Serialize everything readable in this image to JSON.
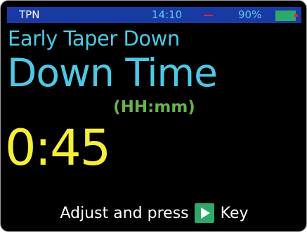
{
  "status_bar": {
    "app_name": "TPN",
    "time": "14:10",
    "battery_percent": "90%",
    "bar_color": "#1a3aa3",
    "battery_color": "#2ea96b",
    "alert_color": "#e3242b"
  },
  "screen": {
    "subtitle": "Early Taper Down",
    "title": "Down Time",
    "units": "(HH:mm)",
    "value": "0:45",
    "title_color": "#4ec8e4",
    "units_color": "#6ab14a",
    "value_color": "#f5ee3b"
  },
  "footer": {
    "text_before": "Adjust and press",
    "key_icon": "play-icon",
    "text_after": "Key"
  }
}
